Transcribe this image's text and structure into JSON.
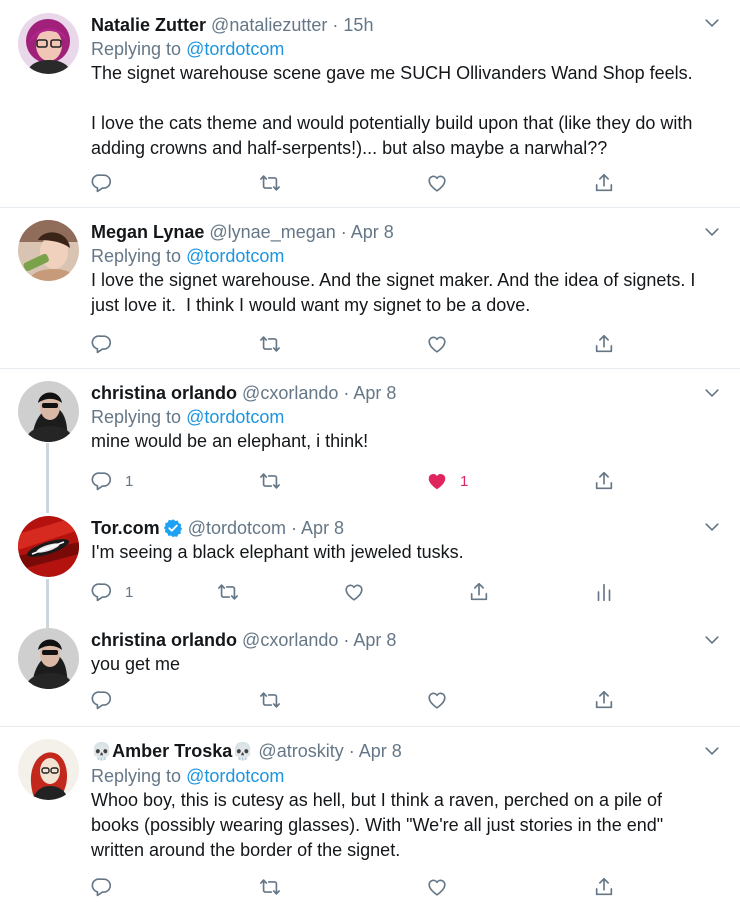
{
  "replying_prefix": "Replying to",
  "colors": {
    "link": "#1b95e0",
    "muted": "#657786",
    "like": "#e0245e",
    "verified": "#1da1f2",
    "border": "#e6ecf0"
  },
  "tweets": [
    {
      "name": "Natalie Zutter",
      "handle": "@nataliezutter",
      "time": "15h",
      "reply_to": "@tordotcom",
      "text": "The signet warehouse scene gave me SUCH Ollivanders Wand Shop feels.\n\nI love the cats theme and would potentially build upon that (like they do with adding crowns and half-serpents!)... but also maybe a narwhal??",
      "reply_count": "",
      "like_count": ""
    },
    {
      "name": "Megan Lynae",
      "handle": "@lynae_megan",
      "time": "Apr 8",
      "reply_to": "@tordotcom",
      "text": "I love the signet warehouse. And the signet maker. And the idea of signets. I just love it.  I think I would want my signet to be a dove.",
      "reply_count": "",
      "like_count": ""
    },
    {
      "name": "christina orlando",
      "handle": "@cxorlando",
      "time": "Apr 8",
      "reply_to": "@tordotcom",
      "text": "mine would be an elephant, i think!",
      "reply_count": "1",
      "like_count": "1",
      "liked": true
    },
    {
      "name": "Tor.com",
      "handle": "@tordotcom",
      "time": "Apr 8",
      "verified": true,
      "text": "I'm seeing a black elephant with jeweled tusks.",
      "reply_count": "1",
      "like_count": ""
    },
    {
      "name": "christina orlando",
      "handle": "@cxorlando",
      "time": "Apr 8",
      "text": "you get me",
      "reply_count": "",
      "like_count": ""
    },
    {
      "name_prefix": "💀",
      "name": "Amber Troska",
      "name_suffix": "💀",
      "handle": "@atroskity",
      "time": "Apr 8",
      "reply_to": "@tordotcom",
      "text": "Whoo boy, this is cutesy as hell, but I think a raven, perched on a pile of books (possibly wearing glasses). With \"We're all just stories in the end\" written around the border of the signet.",
      "reply_count": "",
      "like_count": ""
    }
  ],
  "icons": {
    "reply": "reply-icon",
    "retweet": "retweet-icon",
    "like": "heart-icon",
    "share": "share-icon",
    "analytics": "analytics-icon",
    "caret": "chevron-down-icon",
    "verified": "verified-badge-icon"
  }
}
